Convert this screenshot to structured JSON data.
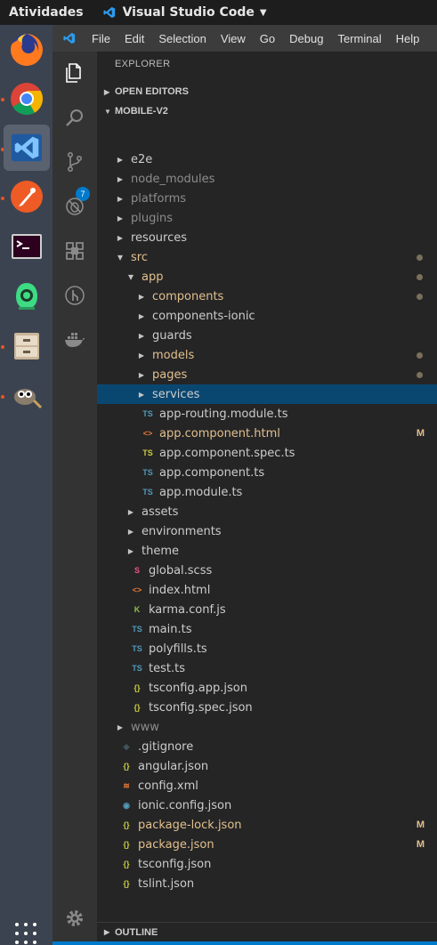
{
  "topbar": {
    "activities": "Atividades",
    "app_name": "Visual Studio Code"
  },
  "menu": [
    "File",
    "Edit",
    "Selection",
    "View",
    "Go",
    "Debug",
    "Terminal",
    "Help"
  ],
  "explorer": {
    "title": "EXPLORER",
    "open_editors": "OPEN EDITORS",
    "project": "MOBILE-V2",
    "outline": "OUTLINE"
  },
  "scm_badge": "7",
  "tree": [
    {
      "name": "e2e",
      "depth": 0,
      "kind": "folder"
    },
    {
      "name": "node_modules",
      "depth": 0,
      "kind": "folder",
      "dim": true
    },
    {
      "name": "platforms",
      "depth": 0,
      "kind": "folder",
      "dim": true
    },
    {
      "name": "plugins",
      "depth": 0,
      "kind": "folder",
      "dim": true
    },
    {
      "name": "resources",
      "depth": 0,
      "kind": "folder"
    },
    {
      "name": "src",
      "depth": 0,
      "kind": "folder-open",
      "mod": true,
      "dot": true
    },
    {
      "name": "app",
      "depth": 1,
      "kind": "folder-open",
      "mod": true,
      "dot": true
    },
    {
      "name": "components",
      "depth": 2,
      "kind": "folder",
      "mod": true,
      "dot": true
    },
    {
      "name": "components-ionic",
      "depth": 2,
      "kind": "folder"
    },
    {
      "name": "guards",
      "depth": 2,
      "kind": "folder"
    },
    {
      "name": "models",
      "depth": 2,
      "kind": "folder",
      "mod": true,
      "dot": true
    },
    {
      "name": "pages",
      "depth": 2,
      "kind": "folder",
      "mod": true,
      "dot": true
    },
    {
      "name": "services",
      "depth": 2,
      "kind": "folder",
      "selected": true
    },
    {
      "name": "app-routing.module.ts",
      "depth": 2,
      "kind": "ts"
    },
    {
      "name": "app.component.html",
      "depth": 2,
      "kind": "html",
      "mod": true,
      "flag": "M"
    },
    {
      "name": "app.component.spec.ts",
      "depth": 2,
      "kind": "ts-spec"
    },
    {
      "name": "app.component.ts",
      "depth": 2,
      "kind": "ts"
    },
    {
      "name": "app.module.ts",
      "depth": 2,
      "kind": "ts"
    },
    {
      "name": "assets",
      "depth": 1,
      "kind": "folder"
    },
    {
      "name": "environments",
      "depth": 1,
      "kind": "folder"
    },
    {
      "name": "theme",
      "depth": 1,
      "kind": "folder"
    },
    {
      "name": "global.scss",
      "depth": 1,
      "kind": "scss"
    },
    {
      "name": "index.html",
      "depth": 1,
      "kind": "html"
    },
    {
      "name": "karma.conf.js",
      "depth": 1,
      "kind": "karma"
    },
    {
      "name": "main.ts",
      "depth": 1,
      "kind": "ts"
    },
    {
      "name": "polyfills.ts",
      "depth": 1,
      "kind": "ts"
    },
    {
      "name": "test.ts",
      "depth": 1,
      "kind": "ts"
    },
    {
      "name": "tsconfig.app.json",
      "depth": 1,
      "kind": "json"
    },
    {
      "name": "tsconfig.spec.json",
      "depth": 1,
      "kind": "json"
    },
    {
      "name": "www",
      "depth": 0,
      "kind": "folder",
      "dim": true
    },
    {
      "name": ".gitignore",
      "depth": 0,
      "kind": "git"
    },
    {
      "name": "angular.json",
      "depth": 0,
      "kind": "json"
    },
    {
      "name": "config.xml",
      "depth": 0,
      "kind": "rss"
    },
    {
      "name": "ionic.config.json",
      "depth": 0,
      "kind": "ionic"
    },
    {
      "name": "package-lock.json",
      "depth": 0,
      "kind": "json",
      "mod": true,
      "flag": "M"
    },
    {
      "name": "package.json",
      "depth": 0,
      "kind": "json",
      "mod": true,
      "flag": "M"
    },
    {
      "name": "tsconfig.json",
      "depth": 0,
      "kind": "json"
    },
    {
      "name": "tslint.json",
      "depth": 0,
      "kind": "json"
    }
  ],
  "icon_glyphs": {
    "folder": "▸",
    "folder-open": "▾",
    "ts": "TS",
    "ts-spec": "TS",
    "html": "<>",
    "scss": "S",
    "karma": "K",
    "json": "{}",
    "git": "◆",
    "rss": "≋",
    "ionic": "◉"
  },
  "colors": {
    "accent": "#007acc",
    "selection": "#094771",
    "modified": "#e2c08d",
    "ts": "#519aba",
    "ts_spec": "#cbcb41",
    "html": "#e37933",
    "json": "#cbcb41",
    "scss": "#f55385",
    "karma": "#8dc149",
    "git": "#41535b",
    "rss": "#e37933",
    "ionic": "#519aba"
  },
  "dock_apps": [
    "firefox-icon",
    "chrome-icon",
    "vscode-icon",
    "postman-icon",
    "terminal-icon",
    "android-studio-icon",
    "file-cabinet-icon",
    "gimp-icon"
  ]
}
